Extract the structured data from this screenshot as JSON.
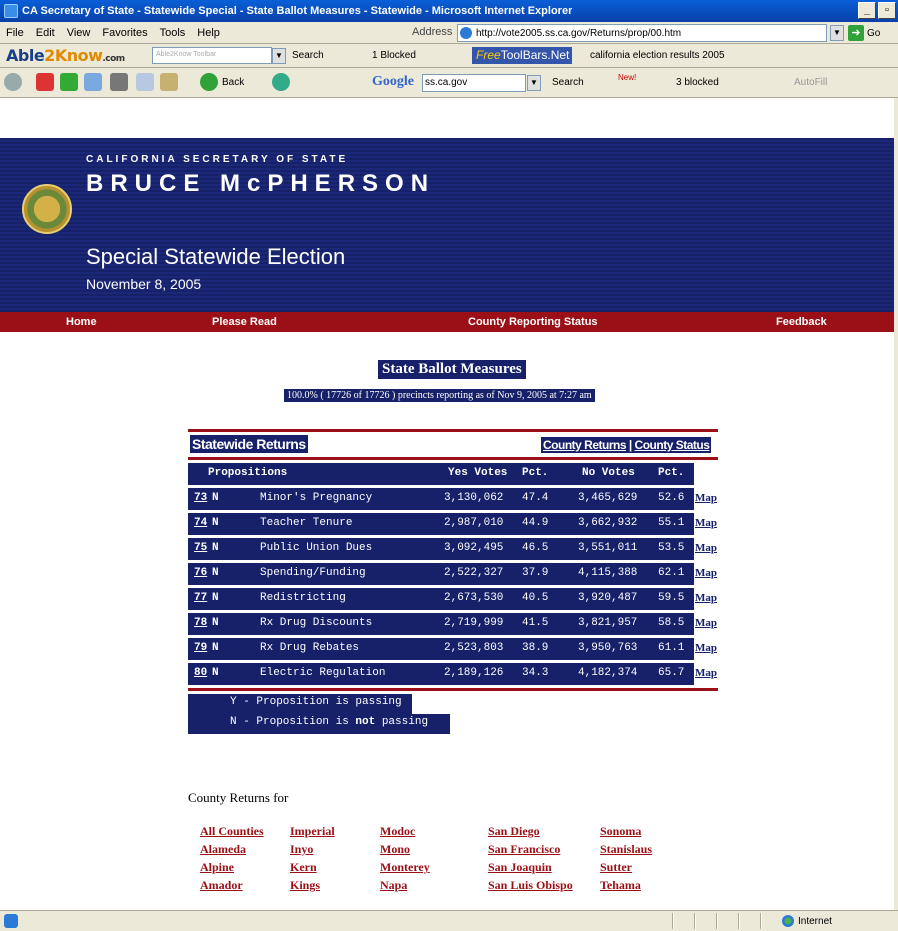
{
  "window": {
    "title": "CA Secretary of State - Statewide Special - State Ballot Measures - Statewide - Microsoft Internet Explorer",
    "min_glyph": "_",
    "max_glyph": "▫"
  },
  "menu": [
    "File",
    "Edit",
    "View",
    "Favorites",
    "Tools",
    "Help"
  ],
  "address": {
    "label": "Address",
    "url": "http://vote2005.ss.ca.gov/Returns/prop/00.htm",
    "go": "Go"
  },
  "toolbar2": {
    "logo_able": "Able",
    "logo_two": "2",
    "logo_know": "Know",
    "logo_com": ".com",
    "input_placeholder": "Able2Know Toolbar",
    "search": "Search",
    "blocked": "1 Blocked",
    "toolbars_brand": "Free",
    "toolbars_name": "ToolBars.Net",
    "terms": "california   election   results   2005"
  },
  "toolbar3": {
    "back": "Back",
    "google": "Google",
    "google_query": "ss.ca.gov",
    "search": "Search",
    "new_badge": "New!",
    "blocked": "3 blocked",
    "autofill": "AutoFill"
  },
  "header": {
    "agency": "CALIFORNIA SECRETARY OF STATE",
    "name": "BRUCE McPHERSON",
    "election": "Special Statewide Election",
    "date": "November 8, 2005"
  },
  "nav": [
    "Home",
    "Please Read",
    "County Reporting Status",
    "Feedback"
  ],
  "page": {
    "title": "State Ballot Measures",
    "subtitle": "100.0% ( 17726 of 17726 ) precincts reporting as of Nov 9, 2005 at 7:27 am",
    "section": "Statewide Returns",
    "county_returns": "County Returns",
    "separator": "|",
    "county_status": "County Status"
  },
  "table": {
    "headers": [
      "Propositions",
      "Yes Votes",
      "Pct.",
      "No Votes",
      "Pct."
    ],
    "map_label": "Map",
    "rows": [
      {
        "num": "73",
        "status": "N",
        "name": "Minor's Pregnancy",
        "yes": "3,130,062",
        "yes_pct": "47.4",
        "no": "3,465,629",
        "no_pct": "52.6"
      },
      {
        "num": "74",
        "status": "N",
        "name": "Teacher Tenure",
        "yes": "2,987,010",
        "yes_pct": "44.9",
        "no": "3,662,932",
        "no_pct": "55.1"
      },
      {
        "num": "75",
        "status": "N",
        "name": "Public Union Dues",
        "yes": "3,092,495",
        "yes_pct": "46.5",
        "no": "3,551,011",
        "no_pct": "53.5"
      },
      {
        "num": "76",
        "status": "N",
        "name": "Spending/Funding",
        "yes": "2,522,327",
        "yes_pct": "37.9",
        "no": "4,115,388",
        "no_pct": "62.1"
      },
      {
        "num": "77",
        "status": "N",
        "name": "Redistricting",
        "yes": "2,673,530",
        "yes_pct": "40.5",
        "no": "3,920,487",
        "no_pct": "59.5"
      },
      {
        "num": "78",
        "status": "N",
        "name": "Rx Drug Discounts",
        "yes": "2,719,999",
        "yes_pct": "41.5",
        "no": "3,821,957",
        "no_pct": "58.5"
      },
      {
        "num": "79",
        "status": "N",
        "name": "Rx Drug Rebates",
        "yes": "2,523,803",
        "yes_pct": "38.9",
        "no": "3,950,763",
        "no_pct": "61.1"
      },
      {
        "num": "80",
        "status": "N",
        "name": "Electric Regulation",
        "yes": "2,189,126",
        "yes_pct": "34.3",
        "no": "4,182,374",
        "no_pct": "65.7"
      }
    ]
  },
  "legend": {
    "passing": "Y - Proposition is passing",
    "not_prefix": "N - Proposition is ",
    "not_bold": "not",
    "not_suffix": " passing"
  },
  "counties": {
    "heading": "County Returns for",
    "columns": [
      [
        "All Counties",
        "Alameda",
        "Alpine",
        "Amador"
      ],
      [
        "Imperial",
        "Inyo",
        "Kern",
        "Kings"
      ],
      [
        "Modoc",
        "Mono",
        "Monterey",
        "Napa"
      ],
      [
        "San Diego",
        "San Francisco",
        "San Joaquin",
        "San Luis Obispo"
      ],
      [
        "Sonoma",
        "Stanislaus",
        "Sutter",
        "Tehama"
      ]
    ]
  },
  "status": {
    "zone": "Internet"
  }
}
